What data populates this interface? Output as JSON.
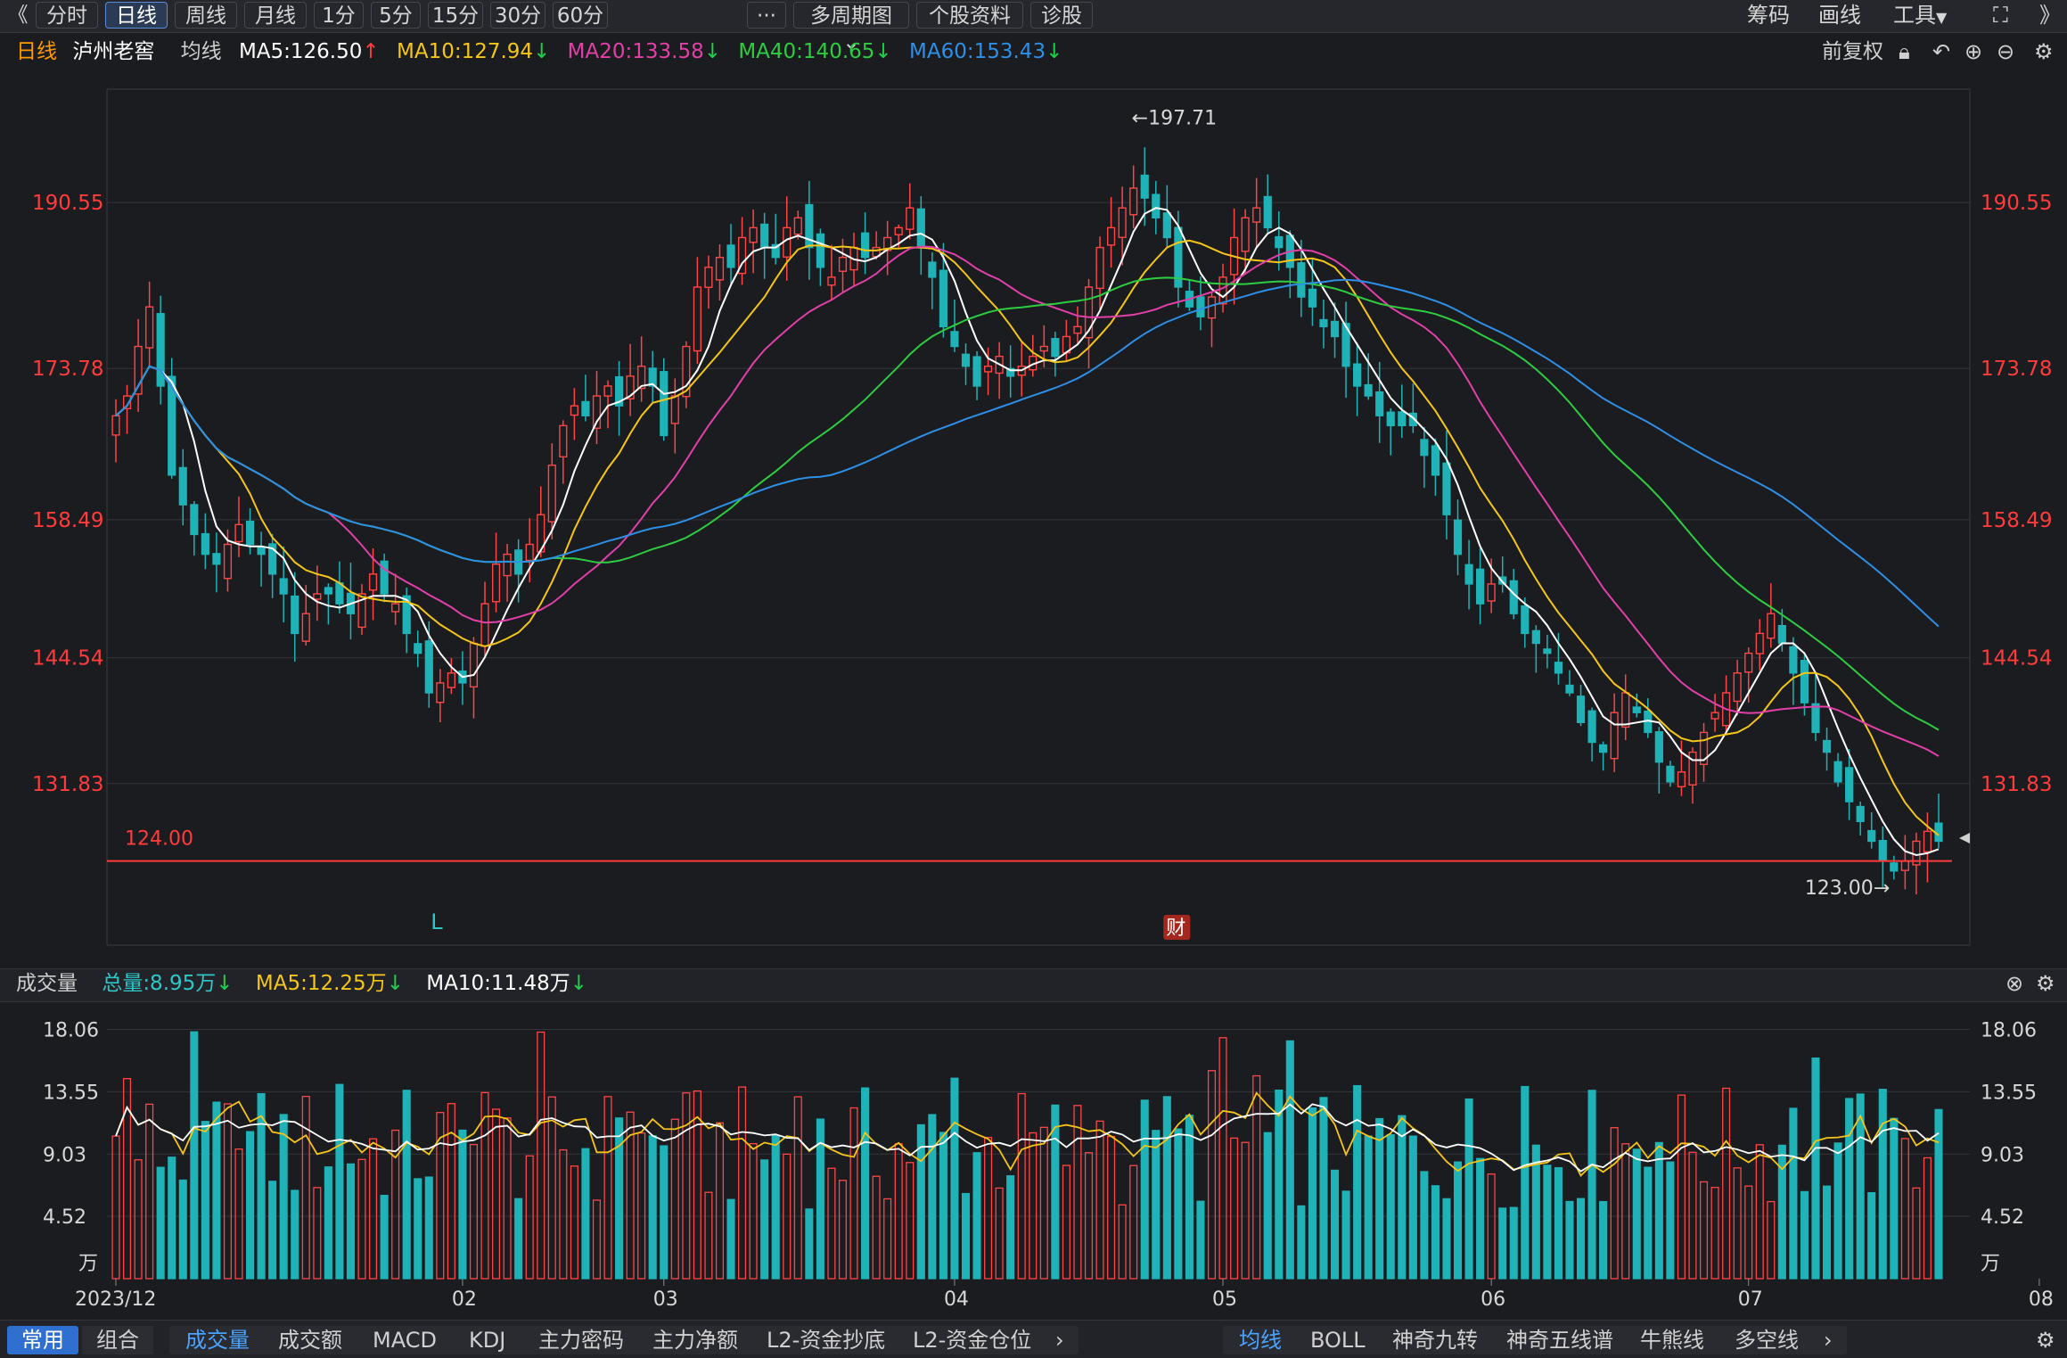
{
  "toolbar": {
    "back_icon": "double-chevron-left-icon",
    "periods": [
      "分时",
      "日线",
      "周线",
      "月线",
      "1分",
      "5分",
      "15分",
      "30分",
      "60分"
    ],
    "active_period": "日线",
    "more_label": "···",
    "multi_period": "多周期图",
    "stock_info": "个股资料",
    "diagnose": "诊股",
    "right": [
      "筹码",
      "画线",
      "工具"
    ]
  },
  "legend_main": {
    "period": "日线",
    "stock": "泸州老窖",
    "indicator": "均线",
    "ma5": "MA5:126.50",
    "ma10": "MA10:127.94",
    "ma20": "MA20:133.58",
    "ma40": "MA40:140.65",
    "ma60": "MA60:153.43",
    "adjust": "前复权",
    "colors": {
      "ma5": "#ffffff",
      "ma10": "#f5c518",
      "ma20": "#e040a8",
      "ma40": "#2ecc40",
      "ma60": "#2e8fe6"
    }
  },
  "legend_volume": {
    "title": "成交量",
    "total": "总量:8.95万",
    "ma5": "MA5:12.25万",
    "ma10": "MA10:11.48万"
  },
  "chart_data": {
    "type": "candlestick",
    "price_ticks": [
      "190.55",
      "173.78",
      "158.49",
      "144.54",
      "131.83"
    ],
    "price_tick_values": [
      190.55,
      173.78,
      158.49,
      144.54,
      131.83
    ],
    "ylim": [
      115.5,
      202
    ],
    "high_label": "←197.71",
    "low_label": "123.00→",
    "support_line": {
      "value": 124.0,
      "label": "124.00"
    },
    "markers": {
      "L": "L",
      "cai": "财"
    },
    "volume_ticks": [
      "18.06",
      "13.55",
      "9.03",
      "4.52"
    ],
    "volume_tick_values": [
      18.06,
      13.55,
      9.03,
      4.52
    ],
    "volume_unit": "万",
    "x_labels": [
      "2023/12",
      "02",
      "03",
      "04",
      "05",
      "06",
      "07",
      "08"
    ],
    "x_label_index": [
      0,
      31,
      49,
      75,
      99,
      123,
      146,
      172
    ],
    "closes": [
      169,
      171,
      176,
      180,
      172,
      163,
      160,
      157,
      155,
      154,
      156,
      158,
      156,
      155,
      153,
      151,
      147,
      149,
      151,
      151,
      150,
      149,
      151,
      153,
      151,
      150,
      147,
      145,
      141,
      142,
      143,
      142,
      146,
      150,
      154,
      155,
      153,
      156,
      159,
      164,
      168,
      170,
      169,
      171,
      172,
      170,
      173,
      174,
      172,
      167,
      171,
      176,
      182,
      184,
      185,
      184,
      187,
      188,
      186,
      185,
      188,
      189,
      186,
      184,
      183,
      185,
      186,
      185,
      186,
      187,
      188,
      190,
      186,
      183,
      178,
      176,
      174,
      172,
      174,
      175,
      173,
      174,
      175,
      176,
      175,
      177,
      178,
      182,
      186,
      188,
      190,
      192,
      191,
      189,
      187,
      182,
      180,
      179,
      181,
      183,
      187,
      189,
      190,
      188,
      186,
      184,
      181,
      180,
      178,
      177,
      174,
      172,
      171,
      169,
      168,
      168,
      168,
      165,
      163,
      159,
      155,
      152,
      150,
      152,
      152,
      149,
      147,
      146,
      145,
      143,
      141,
      138,
      136,
      135,
      139,
      141,
      139,
      137,
      134,
      132,
      133,
      135,
      137,
      139,
      141,
      143,
      145,
      147,
      149,
      146,
      143,
      140,
      137,
      135,
      132,
      130,
      128,
      126,
      124,
      123,
      124,
      126,
      127,
      126
    ]
  }
}
